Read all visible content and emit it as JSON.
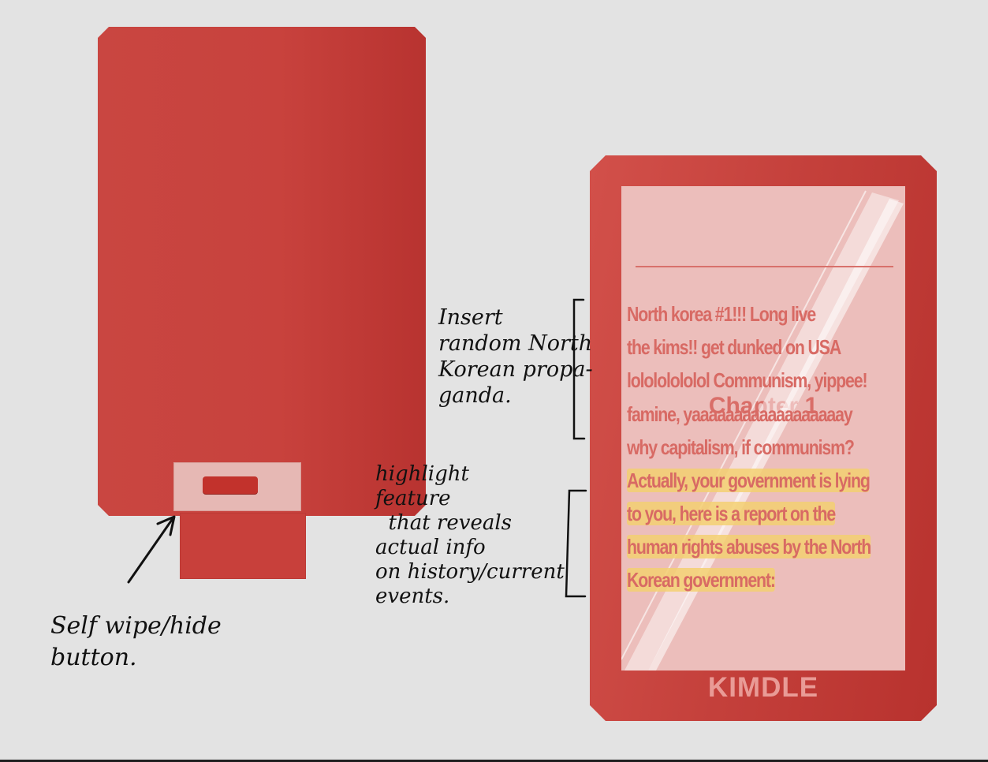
{
  "device_back": {
    "notes": {
      "hide_button": "Self wipe/hide\nbutton."
    }
  },
  "device_front": {
    "chapter_title": "Chapter 1",
    "brand": "KIMDLE",
    "text_lines": [
      "North korea #1!!! Long live",
      "the kims!! get dunked on USA",
      "lolololololol Communism, yippee!",
      "famine, yaaaaaaaaaaaaaaaaaay",
      "why capitalism, if communism?"
    ],
    "highlighted_lines": [
      "Actually,  your government is lying",
      "to you, here is a report  on the",
      "human rights  abuses by the North",
      "Korean government:"
    ]
  },
  "notes": {
    "propaganda": "Insert\nrandom North\nKorean propa-\nganda.",
    "highlight": "highlight\nfeature\n  that reveals\nactual info\non history/current\nevents."
  },
  "colors": {
    "device_red": "#c8423d",
    "screen": "#ecbebb",
    "highlight": "#f3d071",
    "background": "#e3e3e3"
  }
}
